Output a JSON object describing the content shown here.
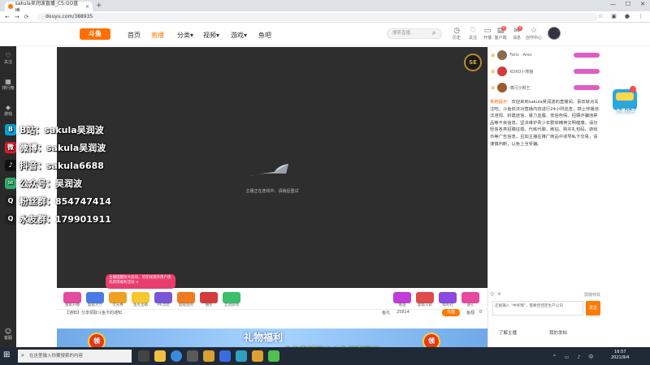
{
  "browser": {
    "tab_title": "sakula吴润波直播_CS:GO直播...",
    "url": "douyu.com/388935",
    "back_glyph": "←",
    "forward_glyph": "→",
    "reload_glyph": "⟳",
    "new_tab_glyph": "+",
    "close_tab_glyph": "×"
  },
  "header": {
    "logo_text": "斗鱼",
    "nav": [
      "首页",
      "直播",
      "分类▾",
      "视频▾",
      "游戏▾",
      "鱼吧"
    ],
    "active_nav_color": "#ff7a00",
    "search_placeholder": "搜索直播",
    "icons": [
      {
        "label": "历史",
        "icon": "history-icon",
        "badge": ""
      },
      {
        "label": "关注",
        "icon": "follow-icon",
        "badge": ""
      },
      {
        "label": "开播",
        "icon": "broadcast-icon",
        "badge": ""
      },
      {
        "label": "客户端",
        "icon": "client-icon",
        "badge": "6"
      },
      {
        "label": "消息",
        "icon": "message-icon",
        "badge": "9"
      },
      {
        "label": "创作中心",
        "icon": "creator-icon",
        "badge": ""
      }
    ]
  },
  "sidebar": {
    "items": [
      {
        "label": "关注",
        "icon": "heart-icon"
      },
      {
        "label": "排行榜",
        "icon": "rank-icon"
      },
      {
        "label": "游戏",
        "icon": "game-icon"
      },
      {
        "label": "直播",
        "icon": "live-icon"
      },
      {
        "label": "娱乐",
        "icon": "ent-icon"
      }
    ],
    "bottom_item": {
      "label": "客服",
      "icon": "service-icon"
    }
  },
  "video": {
    "loading_text": "主播正在连线中，请稍后重试",
    "watermark": "SE",
    "overlay_contacts": [
      {
        "label": "B站：sakula吴润波",
        "color": "#00a1d6",
        "icon": "bilibili-icon",
        "glyph": "B"
      },
      {
        "label": "微博：sakula吴润波",
        "color": "#e6162d",
        "icon": "weibo-icon",
        "glyph": "微"
      },
      {
        "label": "抖音：sakula6688",
        "color": "#111111",
        "icon": "douyin-icon",
        "glyph": "♪"
      },
      {
        "label": "公众号：吴润波",
        "color": "#2aae67",
        "icon": "wechat-icon",
        "glyph": "✉"
      },
      {
        "label": "粉丝群：854747414",
        "color": "#222222",
        "icon": "qq-icon",
        "glyph": "Q"
      },
      {
        "label": "水友群：179901911",
        "color": "#222222",
        "icon": "qq-icon",
        "glyph": "Q"
      }
    ]
  },
  "promo_popup": {
    "text": "主播提醒你大房间，可在找到外用户优先获得福利活动",
    "close": "×"
  },
  "gifts": [
    {
      "label": "独家开播",
      "color": "#e64aa0"
    },
    {
      "label": "超级大厅",
      "color": "#4a7ae6"
    },
    {
      "label": "荧光棒",
      "color": "#f0a020"
    },
    {
      "label": "鱼丸宝箱",
      "color": "#f5c730"
    },
    {
      "label": "PK活动",
      "color": "#7a55d8"
    },
    {
      "label": "超级鱼吧",
      "color": "#f07a20"
    },
    {
      "label": "抽奖",
      "color": "#d23c3c"
    },
    {
      "label": "互动游戏",
      "color": "#3cbf6a"
    }
  ],
  "right_gifts": [
    {
      "label": "赠送",
      "color": "#c23cd8"
    },
    {
      "label": "超级火箭",
      "color": "#e04a4a"
    },
    {
      "label": "福利社",
      "color": "#8a4ae0"
    },
    {
      "label": "送礼",
      "color": "#e64aa0"
    }
  ],
  "infobar": {
    "notice": "【通知】分享领取斗鱼卡的通知",
    "fish_count_label": "鱼丸",
    "fish_count": "25814",
    "recharge_btn": "充值",
    "fish_bar_label": "鱼翅",
    "fish_bar": "0"
  },
  "banner": {
    "title": "礼物福利",
    "left_badge": "领",
    "right_badge": "领",
    "subtitle": "点击直播下方斗鱼福利下单"
  },
  "rank": [
    {
      "name": "Felix · Ares"
    },
    {
      "name": "KOKO小熊猫"
    },
    {
      "name": "傅闪沙狮王"
    }
  ],
  "notice": {
    "label": "系统提示：",
    "body": "欢迎来到sakula吴润波的直播间，喜欢就点关注吧。斗鱼依法对直播内容进行24小时巡查，禁止传播违法违规、封建迷信、暴力血腥、低俗色情、招嫖诈骗违禁品等不良信息，坚决维护青少年群体精神文明健康。请勿轻信各类招聘征婚、代练代聊、刷钻、购买礼包码、游戏币等广告信息，且如主播在推广商品中诱导私下交易，请谨慎判断，以免上当受骗。"
  },
  "chat": {
    "input_placeholder": "还能输入 \"中奖哦\"，需要佳佳定生产公司",
    "send": "发送",
    "block_label": "屏蔽特效"
  },
  "rpanel_tabs": [
    "了解主播",
    "我的发帖"
  ],
  "activity": {
    "label": "主播任务"
  },
  "taskbar": {
    "start": "⊞",
    "search_placeholder": "在这里输入你要搜索的内容",
    "time": "16:57",
    "date": "2021/9/4"
  }
}
